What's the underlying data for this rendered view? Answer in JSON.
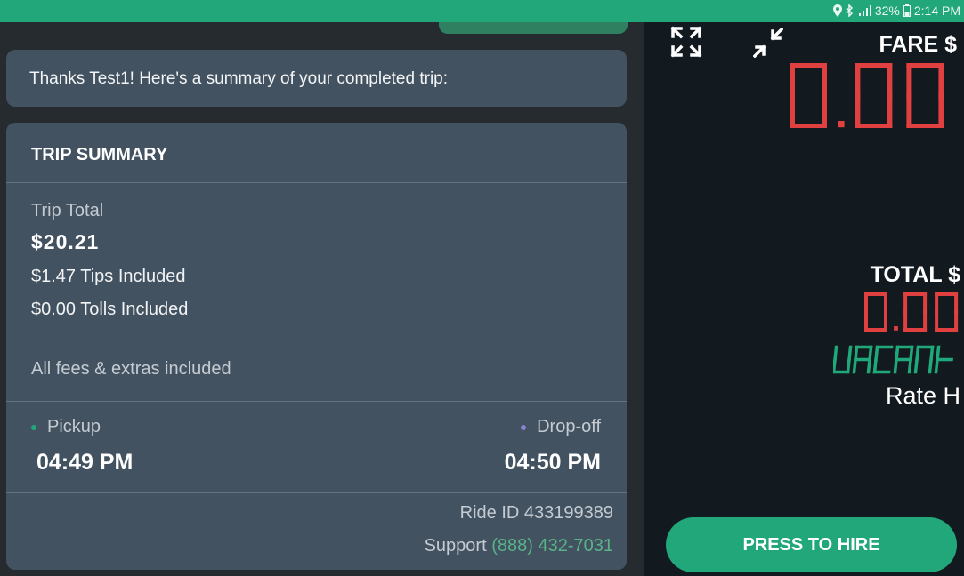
{
  "status_bar": {
    "battery": "32%",
    "time": "2:14 PM",
    "icons": [
      "location-icon",
      "bluetooth-icon",
      "lte-signal-icon",
      "battery-icon"
    ]
  },
  "chat": {
    "message": "Thanks Test1! Here's a summary of your completed trip:"
  },
  "summary": {
    "title": "TRIP SUMMARY",
    "trip_total_label": "Trip Total",
    "trip_total_value": "$20.21",
    "tips": "$1.47 Tips Included",
    "tolls": "$0.00 Tolls Included",
    "fees_note": "All fees & extras included",
    "pickup_label": "Pickup",
    "pickup_time": "04:49 PM",
    "dropoff_label": "Drop-off",
    "dropoff_time": "04:50 PM",
    "ride_id": "Ride ID 433199389",
    "support_label": "Support",
    "support_phone": "(888) 432-7031"
  },
  "meter": {
    "fare_label": "FARE $",
    "fare_value": "0.00",
    "total_label": "TOTAL $",
    "total_value": "0.00",
    "status": "VACANT",
    "rate": "Rate H",
    "hire_button": "PRESS TO HIRE"
  },
  "colors": {
    "accent": "#22a77a",
    "meter_red": "#e0403f",
    "meter_green": "#1fa97a",
    "card": "#435260",
    "pickup_dot": "#22a77a",
    "dropoff_dot": "#8a84d6"
  }
}
